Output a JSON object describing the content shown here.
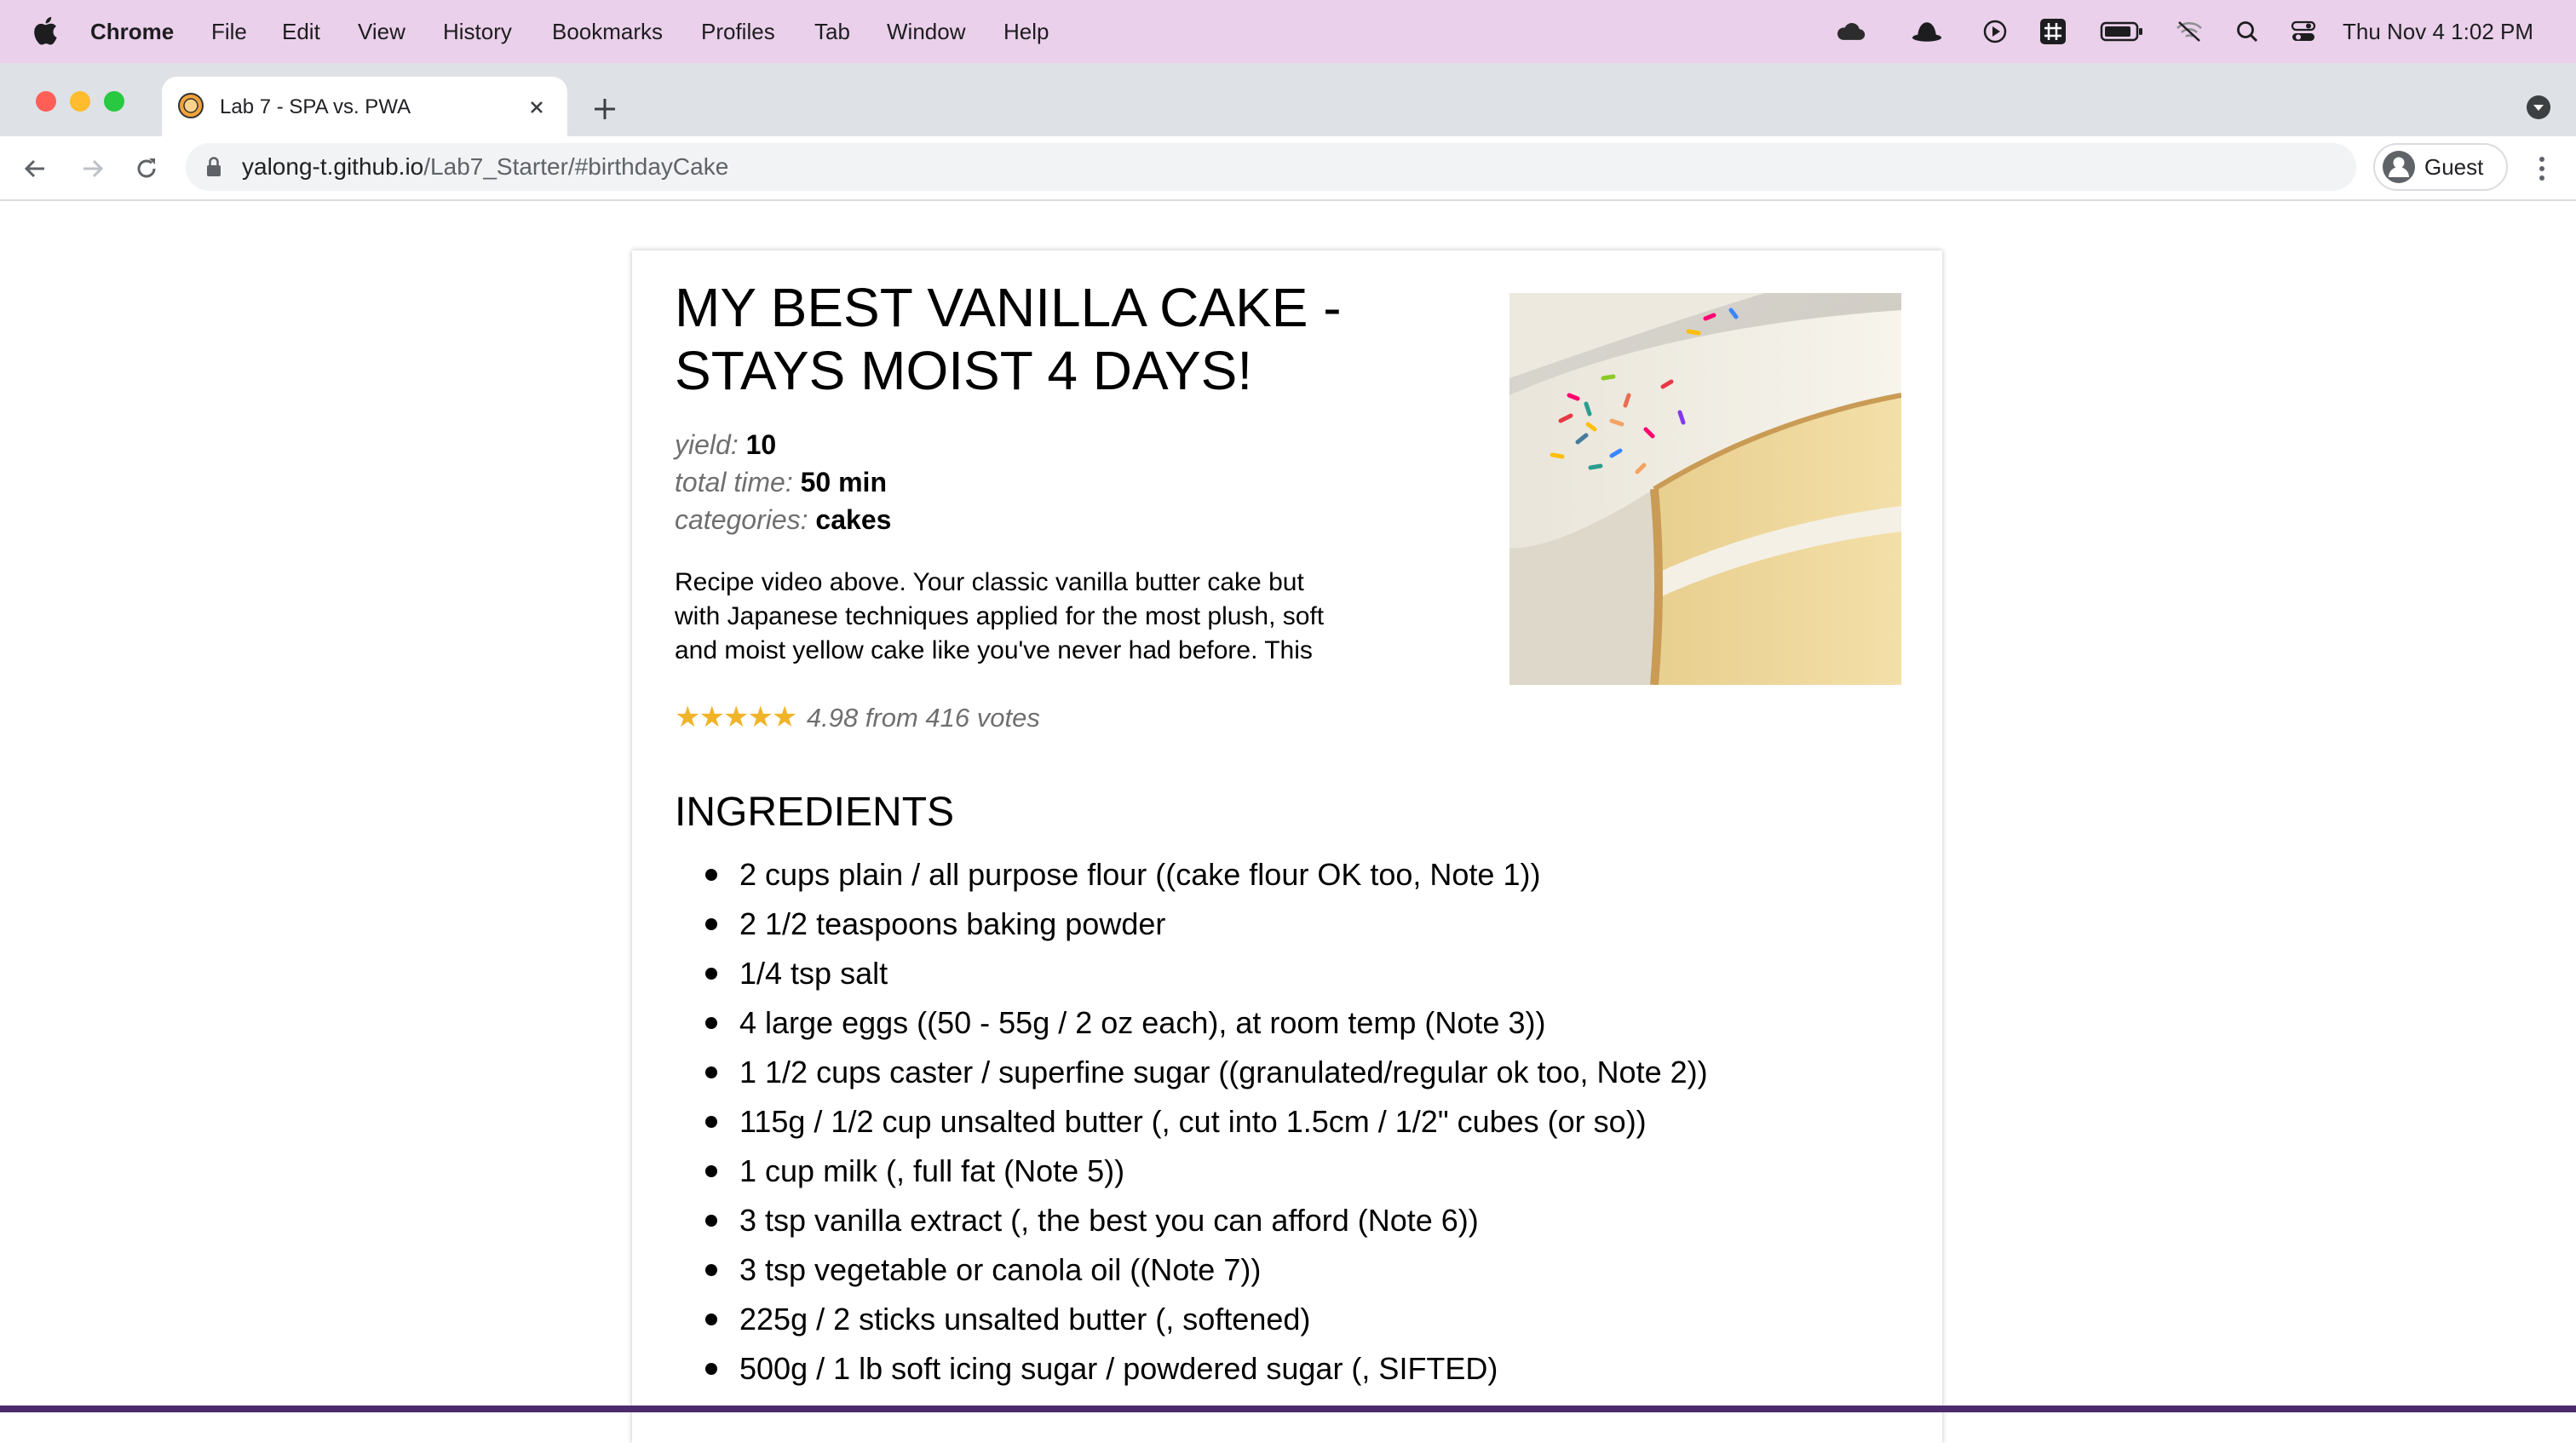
{
  "menubar": {
    "app": "Chrome",
    "items": [
      "File",
      "Edit",
      "View",
      "History",
      "Bookmarks",
      "Profiles",
      "Tab",
      "Window",
      "Help"
    ],
    "clock": "Thu Nov 4  1:02 PM"
  },
  "browser": {
    "tab_title": "Lab 7 - SPA vs. PWA",
    "url_domain": "yalong-t.github.io",
    "url_path": "/Lab7_Starter/#birthdayCake",
    "profile": "Guest"
  },
  "recipe": {
    "title_line1": "MY BEST VANILLA CAKE -",
    "title_line2": "STAYS MOIST 4 DAYS!",
    "yield_label": "yield:",
    "yield_value": "10",
    "time_label": "total time:",
    "time_value": "50 min",
    "categories_label": "categories:",
    "categories_value": "cakes",
    "description_lines": [
      "Recipe video above. Your classic vanilla butter cake but",
      "with Japanese techniques applied for the most plush, soft",
      "and moist yellow cake like you've never had before. This"
    ],
    "stars": "★★★★★",
    "rating_text": "4.98 from 416 votes",
    "ingredients_heading": "INGREDIENTS",
    "ingredients": [
      "2 cups plain / all purpose flour ((cake flour OK too, Note 1))",
      "2 1/2 teaspoons baking powder",
      "1/4 tsp salt",
      "4 large eggs ((50 - 55g / 2 oz each), at room temp (Note 3))",
      "1 1/2 cups caster / superfine sugar ((granulated/regular ok too, Note 2))",
      "115g / 1/2 cup unsalted butter (, cut into 1.5cm / 1/2\" cubes (or so))",
      "1 cup milk (, full fat (Note 5))",
      "3 tsp vanilla extract (, the best you can afford (Note 6))",
      "3 tsp vegetable or canola oil ((Note 7))",
      "225g / 2 sticks unsalted butter (, softened)",
      "500g / 1 lb soft icing sugar / powdered sugar (, SIFTED)"
    ]
  },
  "colors": {
    "menubar_bg": "#ead0ea",
    "tabstrip_bg": "#dee1e6",
    "star": "#f0b429",
    "meta_label": "#6f6f6f"
  }
}
